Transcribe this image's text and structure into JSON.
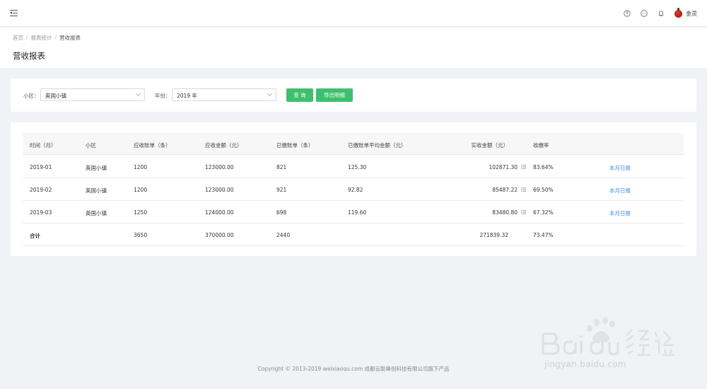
{
  "breadcrumb": {
    "home": "首页",
    "reports": "报表统计",
    "current": "营收报表",
    "sep": "/"
  },
  "page_title": "营收报表",
  "user": {
    "name": "金灵"
  },
  "icons": {
    "menu": "menu-fold-icon",
    "help": "help-circle-icon",
    "message": "message-icon",
    "bell": "bell-icon",
    "avatar": "apple-avatar"
  },
  "filters": {
    "community_label": "小区：",
    "community_value": "英国小镇",
    "year_label": "年份：",
    "year_value": "2019 年",
    "query_button": "查 询",
    "export_button": "导出明细"
  },
  "table": {
    "headers": [
      "时间（月）",
      "小区",
      "应收账单（条）",
      "应收金额（元）",
      "已缴账单（条）",
      "已缴账单平均金额（元）",
      "实收金额（元）",
      "收缴率"
    ],
    "rows": [
      {
        "month": "2019-01",
        "community": "英国小镇",
        "bills_due": "1200",
        "amount_due": "123000.00",
        "bills_paid": "821",
        "avg_paid": "125.30",
        "received": "102871.30",
        "rate": "83.64%",
        "action": "本月日报"
      },
      {
        "month": "2019-02",
        "community": "英国小镇",
        "bills_due": "1200",
        "amount_due": "123000.00",
        "bills_paid": "921",
        "avg_paid": "92.82",
        "received": "85487.22",
        "rate": "69.50%",
        "action": "本月日报"
      },
      {
        "month": "2019-03",
        "community": "英国小镇",
        "bills_due": "1250",
        "amount_due": "124000.00",
        "bills_paid": "698",
        "avg_paid": "119.60",
        "received": "83480.80",
        "rate": "67.32%",
        "action": "本月日报"
      }
    ],
    "total": {
      "label": "合计",
      "bills_due": "3650",
      "amount_due": "370000.00",
      "bills_paid": "2440",
      "received": "271839.32",
      "rate": "73.47%"
    }
  },
  "footer": "Copyright © 2013-2019 weixiaoqu.com 成都云联峰创科技有限公司旗下产品",
  "watermark": {
    "brand": "Bai 经验",
    "url": "jingyan.baidu.com"
  },
  "colors": {
    "primary_green": "#3dbf6e",
    "link_blue": "#3a8ee6"
  }
}
